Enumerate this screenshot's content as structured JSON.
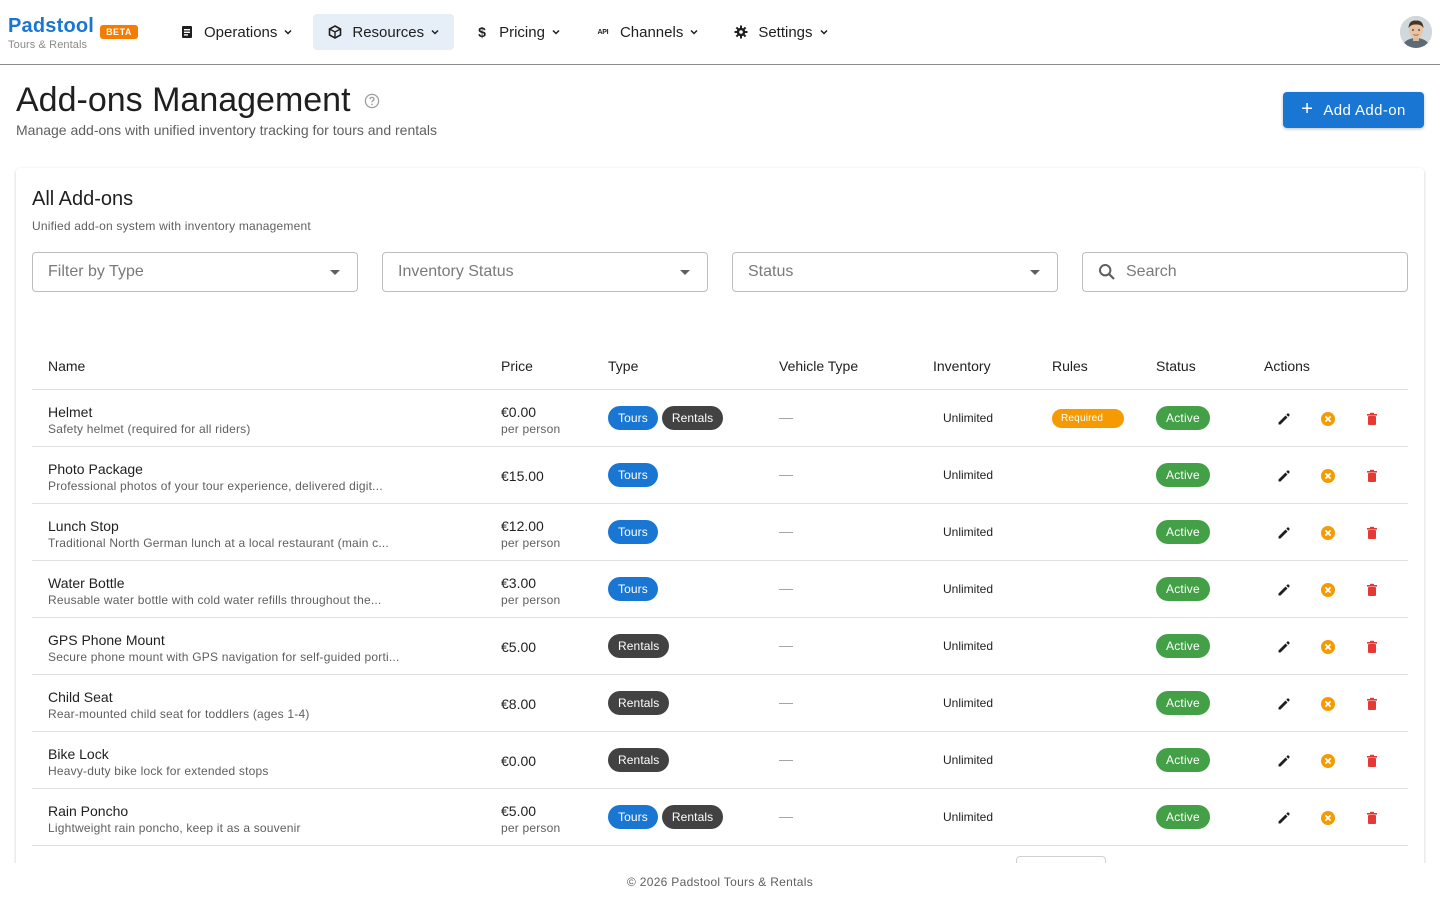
{
  "app": {
    "brand_name": "Padstool",
    "beta_badge": "BETA",
    "brand_sub": "Tours & Rentals"
  },
  "nav": {
    "items": [
      {
        "label": "Operations",
        "icon": "clipboard-icon",
        "active": false
      },
      {
        "label": "Resources",
        "icon": "cube-icon",
        "active": true
      },
      {
        "label": "Pricing",
        "icon": "dollar-icon",
        "active": false
      },
      {
        "label": "Channels",
        "icon": "api-icon",
        "active": false
      },
      {
        "label": "Settings",
        "icon": "gear-icon",
        "active": false
      }
    ]
  },
  "header": {
    "title": "Add-ons Management",
    "subtitle": "Manage add-ons with unified inventory tracking for tours and rentals",
    "add_button": "Add Add-on"
  },
  "card": {
    "title": "All Add-ons",
    "subtitle": "Unified add-on system with inventory management"
  },
  "filters": {
    "type_placeholder": "Filter by Type",
    "inventory_placeholder": "Inventory Status",
    "status_placeholder": "Status",
    "search_placeholder": "Search"
  },
  "table": {
    "columns": [
      "Name",
      "Price",
      "Type",
      "Vehicle Type",
      "Inventory",
      "Rules",
      "Status",
      "Actions"
    ],
    "rows": [
      {
        "name": "Helmet",
        "description": "Safety helmet (required for all riders)",
        "price": "€0.00",
        "price_unit": "per person",
        "types": [
          "Tours",
          "Rentals"
        ],
        "vehicle_type": "—",
        "inventory": "Unlimited",
        "rule": "Required",
        "status": "Active"
      },
      {
        "name": "Photo Package",
        "description": "Professional photos of your tour experience, delivered digit...",
        "price": "€15.00",
        "price_unit": "",
        "types": [
          "Tours"
        ],
        "vehicle_type": "—",
        "inventory": "Unlimited",
        "rule": "",
        "status": "Active"
      },
      {
        "name": "Lunch Stop",
        "description": "Traditional North German lunch at a local restaurant (main c...",
        "price": "€12.00",
        "price_unit": "per person",
        "types": [
          "Tours"
        ],
        "vehicle_type": "—",
        "inventory": "Unlimited",
        "rule": "",
        "status": "Active"
      },
      {
        "name": "Water Bottle",
        "description": "Reusable water bottle with cold water refills throughout the...",
        "price": "€3.00",
        "price_unit": "per person",
        "types": [
          "Tours"
        ],
        "vehicle_type": "—",
        "inventory": "Unlimited",
        "rule": "",
        "status": "Active"
      },
      {
        "name": "GPS Phone Mount",
        "description": "Secure phone mount with GPS navigation for self-guided porti...",
        "price": "€5.00",
        "price_unit": "",
        "types": [
          "Rentals"
        ],
        "vehicle_type": "—",
        "inventory": "Unlimited",
        "rule": "",
        "status": "Active"
      },
      {
        "name": "Child Seat",
        "description": "Rear-mounted child seat for toddlers (ages 1-4)",
        "price": "€8.00",
        "price_unit": "",
        "types": [
          "Rentals"
        ],
        "vehicle_type": "—",
        "inventory": "Unlimited",
        "rule": "",
        "status": "Active"
      },
      {
        "name": "Bike Lock",
        "description": "Heavy-duty bike lock for extended stops",
        "price": "€0.00",
        "price_unit": "",
        "types": [
          "Rentals"
        ],
        "vehicle_type": "—",
        "inventory": "Unlimited",
        "rule": "",
        "status": "Active"
      },
      {
        "name": "Rain Poncho",
        "description": "Lightweight rain poncho, keep it as a souvenir",
        "price": "€5.00",
        "price_unit": "per person",
        "types": [
          "Tours",
          "Rentals"
        ],
        "vehicle_type": "—",
        "inventory": "Unlimited",
        "rule": "",
        "status": "Active"
      }
    ]
  },
  "footer": {
    "text": "© 2026 Padstool Tours & Rentals"
  },
  "colors": {
    "primary": "#1976d2",
    "beta": "#f57c00",
    "chip_rentals": "#424242",
    "status_active": "#43a047",
    "rule_required": "#f59a00",
    "deactivate": "#f59a00",
    "delete": "#e53935"
  }
}
